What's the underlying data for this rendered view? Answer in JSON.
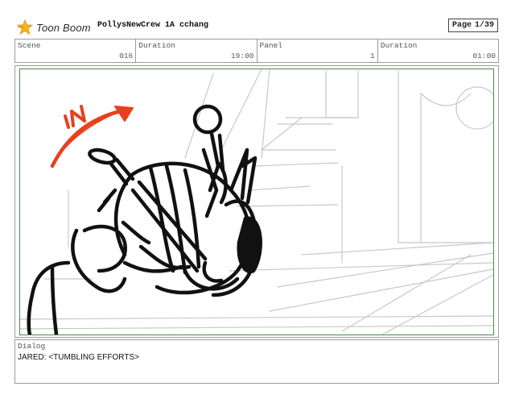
{
  "header": {
    "brand": "Toon Boom",
    "doc_title": "PollysNewCrew 1A cchang",
    "page_label": "Page",
    "page_value": "1/39"
  },
  "info": [
    {
      "label": "Scene",
      "value": "016"
    },
    {
      "label": "Duration",
      "value": "19:00"
    },
    {
      "label": "Panel",
      "value": "1"
    },
    {
      "label": "Duration",
      "value": "01:00"
    }
  ],
  "panel": {
    "annotation": "IN",
    "colors": {
      "frame": "#4a8a4a",
      "annotation": "#e8401c",
      "background_lines": "#c8c8c8",
      "ink": "#111111"
    }
  },
  "dialog": {
    "label": "Dialog",
    "text": "JARED: <TUMBLING EFFORTS>"
  }
}
